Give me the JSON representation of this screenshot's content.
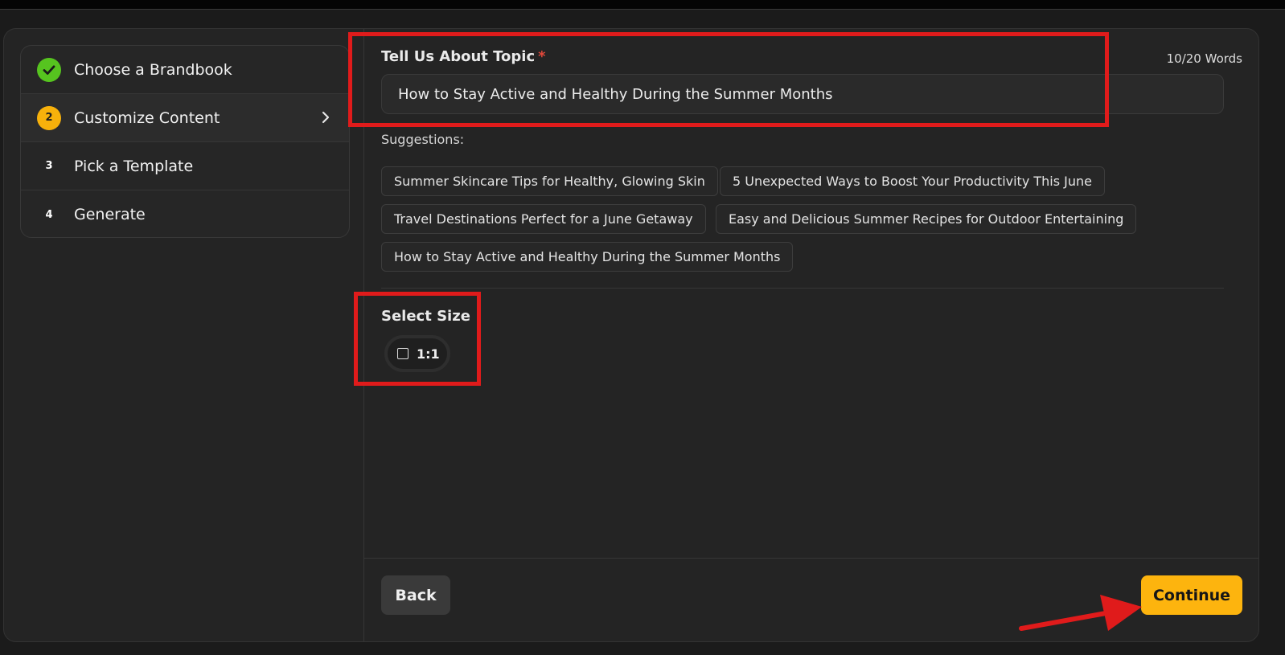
{
  "steps": [
    {
      "number": "",
      "label": "Choose a Brandbook",
      "state": "done",
      "icon": "check-icon"
    },
    {
      "number": "2",
      "label": "Customize Content",
      "state": "current",
      "icon": "chevron-right-icon"
    },
    {
      "number": "3",
      "label": "Pick a Template",
      "state": "pending"
    },
    {
      "number": "4",
      "label": "Generate",
      "state": "pending"
    }
  ],
  "topic": {
    "label": "Tell Us About Topic",
    "required_mark": "*",
    "word_count": "10/20 Words",
    "value": "How to Stay Active and Healthy During the Summer Months"
  },
  "suggestions": {
    "label": "Suggestions:",
    "items": [
      "Summer Skincare Tips for Healthy, Glowing Skin",
      "5 Unexpected Ways to Boost Your Productivity This June",
      "Travel Destinations Perfect for a June Getaway",
      "Easy and Delicious Summer Recipes for Outdoor Entertaining",
      "How to Stay Active and Healthy During the Summer Months"
    ]
  },
  "size": {
    "label": "Select Size",
    "options": [
      {
        "label": "1:1",
        "icon": "square-icon"
      }
    ]
  },
  "footer": {
    "back_label": "Back",
    "continue_label": "Continue"
  },
  "colors": {
    "accent": "#fdb40e",
    "success": "#56c41f",
    "annotation": "#e01b1b"
  }
}
